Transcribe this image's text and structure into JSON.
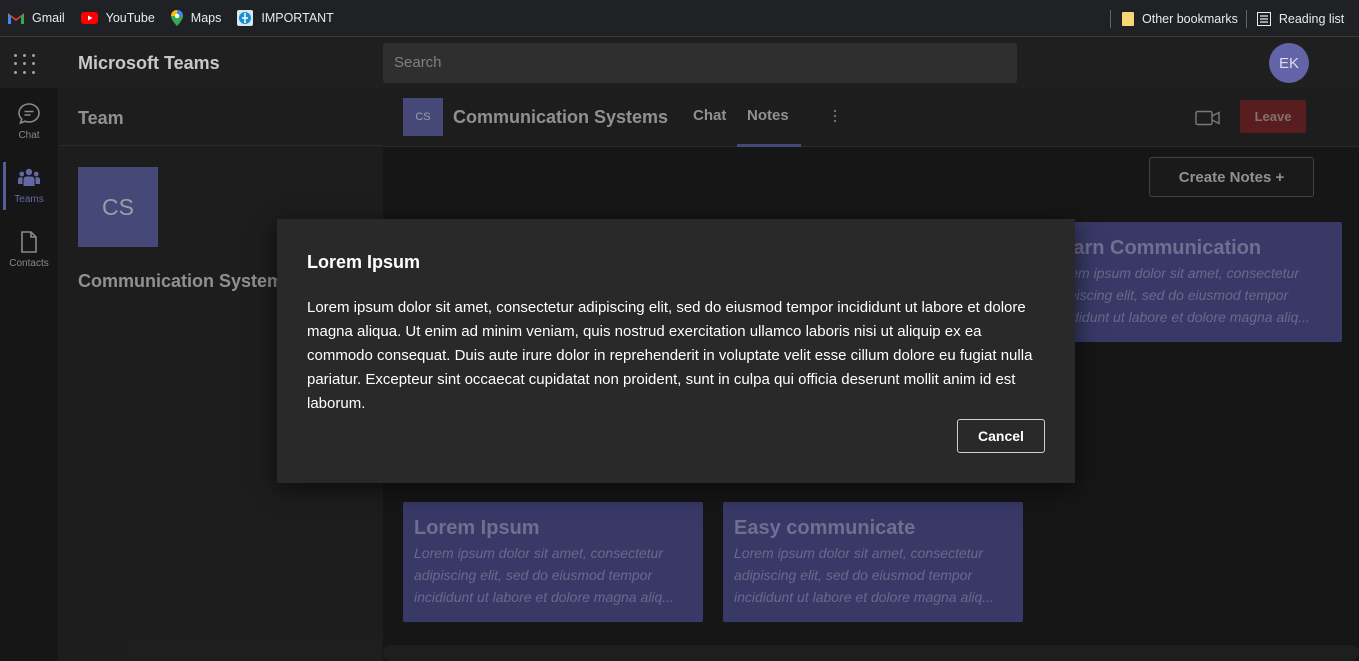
{
  "bookmarks": {
    "items": [
      {
        "label": "Gmail",
        "icon": "gmail-icon"
      },
      {
        "label": "YouTube",
        "icon": "youtube-icon"
      },
      {
        "label": "Maps",
        "icon": "maps-pin-icon"
      },
      {
        "label": "IMPORTANT",
        "icon": "globe-icon"
      }
    ],
    "other": "Other bookmarks",
    "reading": "Reading list"
  },
  "app": {
    "title": "Microsoft Teams",
    "search_placeholder": "Search",
    "avatar": "EK"
  },
  "rail": {
    "items": [
      {
        "label": "Chat",
        "icon": "chat-icon"
      },
      {
        "label": "Teams",
        "icon": "teams-icon"
      },
      {
        "label": "Contacts",
        "icon": "document-icon"
      }
    ]
  },
  "team_panel": {
    "header": "Team",
    "tile": "CS",
    "team_name": "Communication Systems"
  },
  "channel": {
    "avatar": "CS",
    "title": "Communication Systems",
    "tabs": [
      "Chat",
      "Notes"
    ],
    "active_tab": "Notes",
    "leave": "Leave",
    "create": "Create Notes +"
  },
  "notes": [
    {
      "title": "Learn Communication",
      "body": "Lorem ipsum dolor sit amet, consectetur adipiscing elit, sed do eiusmod tempor incididunt ut labore et dolore magna aliq..."
    },
    {
      "title": "Lorem Ipsum",
      "body": "Lorem ipsum dolor sit amet, consectetur adipiscing elit, sed do eiusmod tempor incididunt ut labore et dolore magna aliq..."
    },
    {
      "title": "Easy communicate",
      "body": "Lorem ipsum dolor sit amet, consectetur adipiscing elit, sed do eiusmod tempor incididunt ut labore et dolore magna aliq..."
    }
  ],
  "dialog": {
    "title": "Lorem Ipsum",
    "body": "Lorem ipsum dolor sit amet, consectetur adipiscing elit, sed do eiusmod tempor incididunt ut labore et dolore magna aliqua. Ut enim ad minim veniam, quis nostrud exercitation ullamco laboris nisi ut aliquip ex ea commodo consequat. Duis aute irure dolor in reprehenderit in voluptate velit esse cillum dolore eu fugiat nulla pariatur. Excepteur sint occaecat cupidatat non proident, sunt in culpa qui officia deserunt mollit anim id est laborum.",
    "cancel": "Cancel"
  },
  "colors": {
    "accent": "#6264a7",
    "leave": "#7a2a2c"
  }
}
